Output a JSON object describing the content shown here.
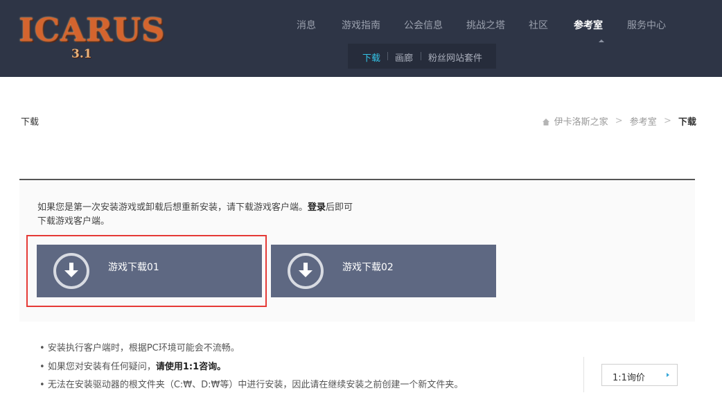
{
  "logo": {
    "main": "ICARUS",
    "version": "3.1"
  },
  "nav": {
    "items": [
      {
        "label": "消息"
      },
      {
        "label": "游戏指南"
      },
      {
        "label": "公会信息"
      },
      {
        "label": "挑战之塔"
      },
      {
        "label": "社区"
      },
      {
        "label": "参考室"
      },
      {
        "label": "服务中心"
      }
    ],
    "active_index": 5
  },
  "subnav": {
    "items": [
      {
        "label": "下载"
      },
      {
        "label": "画廊"
      },
      {
        "label": "粉丝网站套件"
      }
    ],
    "active_index": 0
  },
  "page": {
    "title": "下载",
    "breadcrumb": [
      "伊卡洛斯之家",
      "参考室",
      "下载"
    ]
  },
  "intro": {
    "line1_pre": "如果您是第一次安装游戏或卸载后想重新安装，请下载游戏客户端。",
    "login": "登录",
    "line1_post": "后即可",
    "line2": "下载游戏客户端。"
  },
  "downloads": [
    {
      "label": "游戏下载01"
    },
    {
      "label": "游戏下载02"
    }
  ],
  "notes": {
    "bullet": "•",
    "item1": "安装执行客户端时，根据PC环境可能会不流畅。",
    "item2_pre": "如果您对安装有任何疑问，",
    "item2_bold": "请使用1:1咨询。",
    "item3": "无法在安装驱动器的根文件夹（C:₩、D:₩等）中进行安装，因此请在继续安装之前创建一个新文件夹。"
  },
  "inquiry": {
    "label": "1:1询价"
  },
  "colors": {
    "header_bg": "#2e3546",
    "subnav_active": "#34c3e6",
    "button_bg": "#5e6882",
    "highlight": "#e53935"
  },
  "icons": [
    "download-icon",
    "home-icon",
    "chevron-right-icon"
  ]
}
